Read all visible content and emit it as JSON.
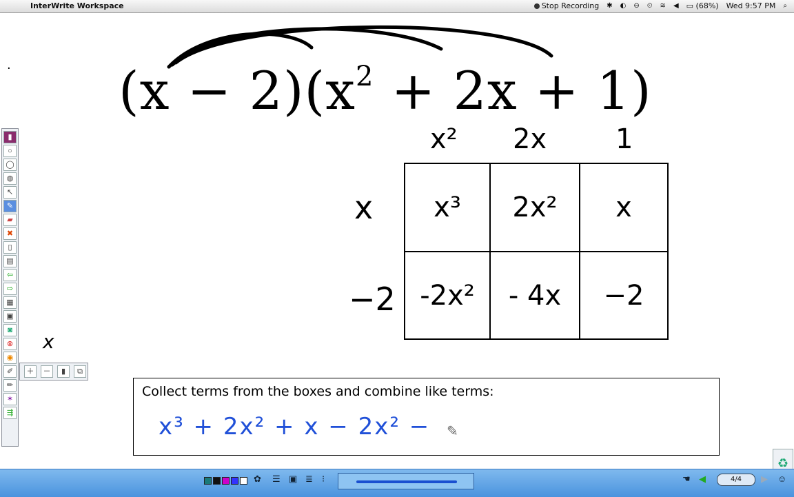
{
  "menubar": {
    "apple": "",
    "app_name": "InterWrite Workspace",
    "stop_recording": "Stop Recording",
    "battery": "(68%)",
    "clock": "Wed 9:57 PM"
  },
  "canvas": {
    "expression": {
      "a": "(x − 2)(x",
      "exp": "2",
      "b": " + 2x + 1)"
    },
    "column_headers": [
      "x²",
      "2x",
      "1"
    ],
    "row_headers": [
      "x",
      "−2"
    ],
    "cells": [
      [
        "x³",
        "2x²",
        "x"
      ],
      [
        "-2x²",
        "- 4x",
        "−2"
      ]
    ],
    "stray_mark": "x",
    "dot": "·"
  },
  "instruction_box": {
    "title": "Collect terms from the boxes and combine like terms:",
    "work": "x³ + 2x² + x − 2x² −"
  },
  "bottombar": {
    "page": "4/4"
  },
  "icons": {
    "menubar": [
      "apple-icon",
      "record-icon",
      "bluetooth-icon",
      "time-machine-icon",
      "wifi-icon",
      "volume-icon",
      "battery-icon",
      "search-icon"
    ],
    "toolbar": [
      "pen-icon",
      "highlighter-icon",
      "eraser-icon",
      "select-icon",
      "shapes-icon",
      "new-page-icon",
      "insert-icon",
      "back-icon",
      "forward-icon",
      "pages-icon",
      "save-icon",
      "screen-icon",
      "close-icon",
      "capture-icon",
      "tools-icon"
    ],
    "bottom": [
      "grid-icon",
      "palette-icon",
      "lines-icon",
      "thick-lines-icon",
      "layout-icon",
      "hand-icon",
      "prev-icon",
      "next-icon",
      "people-icon"
    ]
  },
  "colors": {
    "accent": "#2050d8",
    "bar": "#5ea5e7"
  }
}
